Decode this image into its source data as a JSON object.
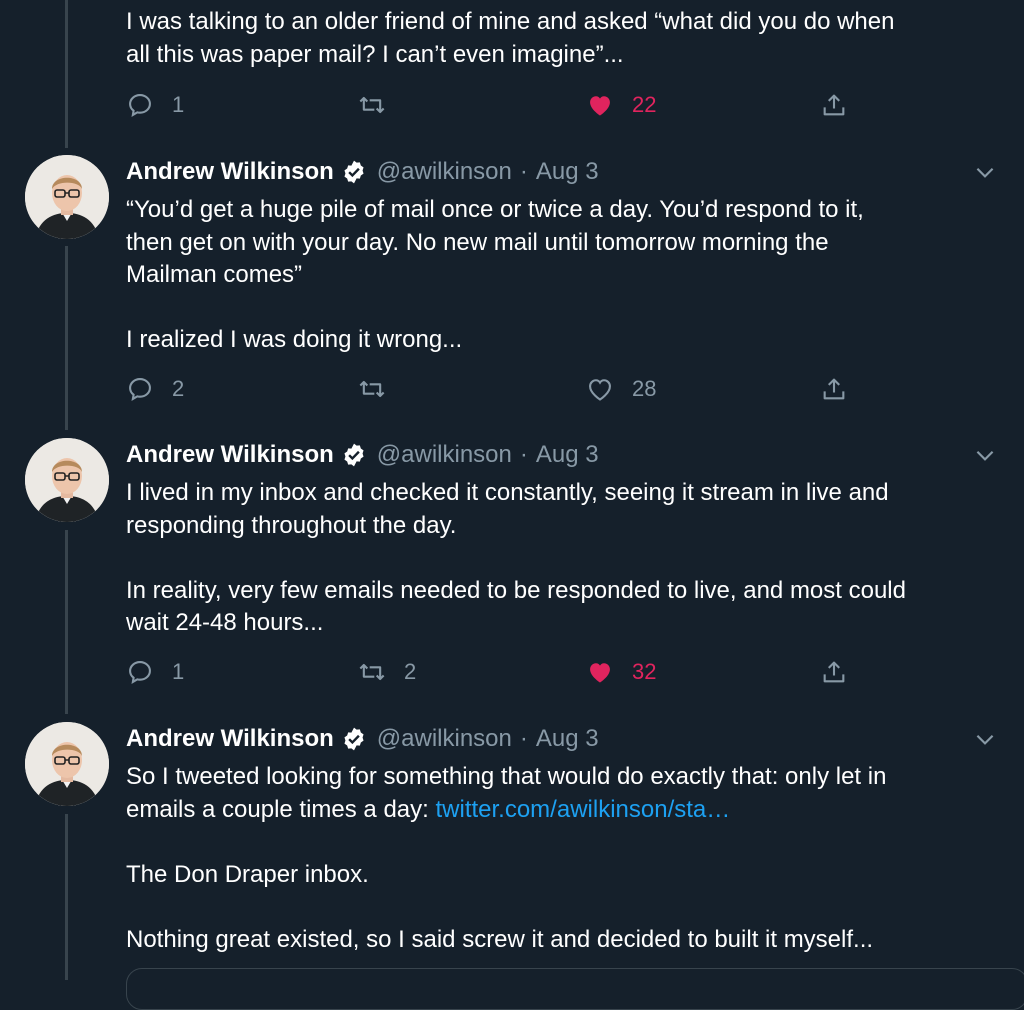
{
  "colors": {
    "background": "#15202b",
    "muted": "#8899a6",
    "like": "#e0245e",
    "link": "#1da1f2",
    "line": "#38444d"
  },
  "top_tweet": {
    "text": "I was talking to an older friend of mine and asked “what did you do when\nall this was paper mail? I can’t even imagine”...",
    "replies": "1",
    "retweets": "",
    "likes": "22",
    "liked": true
  },
  "tweets": [
    {
      "name": "Andrew Wilkinson",
      "handle": "@awilkinson",
      "separator": "·",
      "date": "Aug 3",
      "text": "“You’d get a huge pile of mail once or twice a day. You’d respond to it,\nthen get on with your day. No new mail until tomorrow morning the\nMailman comes”\n\nI realized I was doing it wrong...",
      "replies": "2",
      "retweets": "",
      "likes": "28",
      "liked": false
    },
    {
      "name": "Andrew Wilkinson",
      "handle": "@awilkinson",
      "separator": "·",
      "date": "Aug 3",
      "text": "I lived in my inbox and checked it constantly, seeing it stream in live and\nresponding throughout the day.\n\nIn reality, very few emails needed to be responded to live, and most could\nwait 24-48 hours...",
      "replies": "1",
      "retweets": "2",
      "likes": "32",
      "liked": true
    },
    {
      "name": "Andrew Wilkinson",
      "handle": "@awilkinson",
      "separator": "·",
      "date": "Aug 3",
      "text_before_link": "So I tweeted looking for something that would do exactly that: only let in\nemails a couple times a day: ",
      "link": "twitter.com/awilkinson/sta…",
      "text_after_link": "\n\nThe Don Draper inbox.\n\nNothing great existed, so I said screw it and decided to built it myself..."
    }
  ]
}
